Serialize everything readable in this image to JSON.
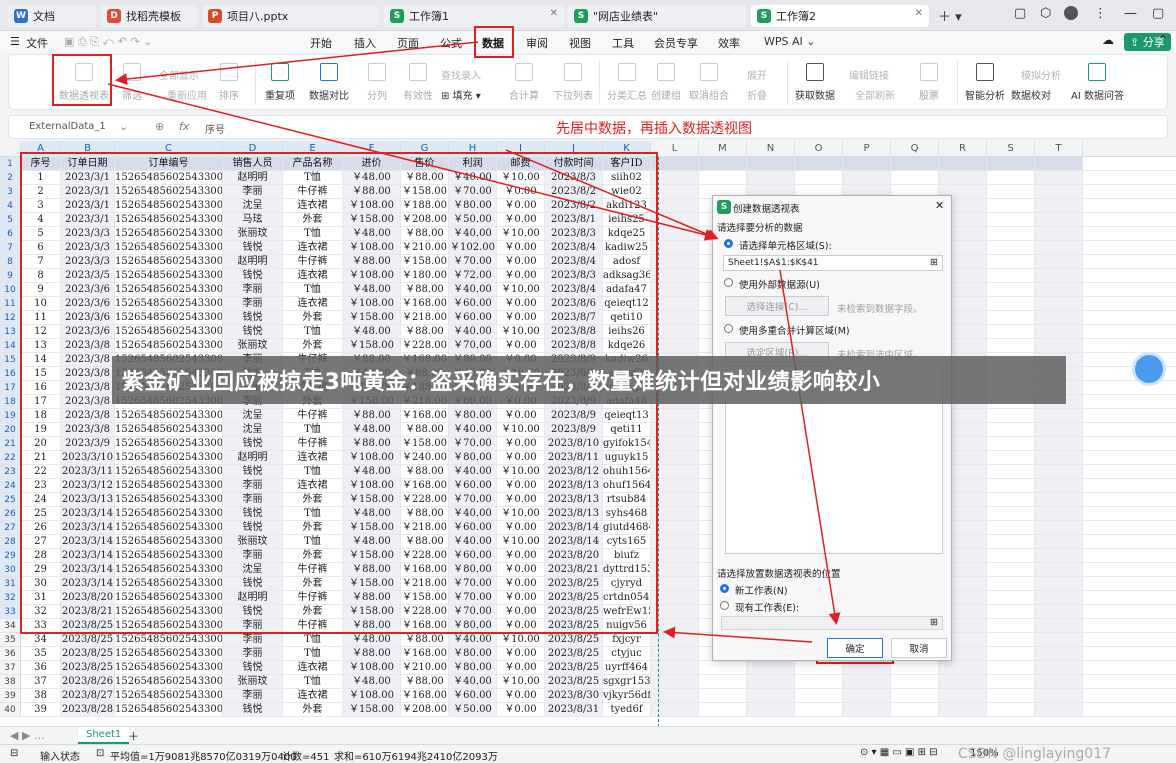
{
  "tabs": [
    {
      "label": "文档",
      "icon": "doc-icon",
      "color": "#2f6fd6"
    },
    {
      "label": "找稻壳模板",
      "icon": "docer-icon",
      "color": "#e24b3b"
    },
    {
      "label": "项目八.pptx",
      "icon": "ppt-icon",
      "color": "#d94a2a"
    },
    {
      "label": "工作簿1",
      "icon": "sheet-icon",
      "color": "#1e9e5a"
    },
    {
      "label": "\"网店业绩表\"",
      "icon": "sheet-icon",
      "color": "#1e9e5a"
    },
    {
      "label": "工作簿2",
      "icon": "sheet-icon",
      "color": "#1e9e5a"
    }
  ],
  "menu": {
    "file": "文件",
    "items": [
      "开始",
      "插入",
      "页面",
      "公式",
      "数据",
      "审阅",
      "视图",
      "工具",
      "会员专享",
      "效率"
    ],
    "wps_ai": "WPS AI",
    "share": "分享"
  },
  "ribbon": {
    "pivot": "数据透视表",
    "filter": "筛选",
    "show_all": "全部显示",
    "reapply": "重新应用",
    "sort": "排序",
    "dup": "重复项",
    "compare": "数据对比",
    "split": "分列",
    "validity": "有效性",
    "find_entry": "查找录入",
    "fill": "填充",
    "sum": "合计算",
    "dropdown": "下拉列表",
    "subtotal": "分类汇总",
    "create_group": "创建组",
    "ungroup": "取消组合",
    "expand": "展开",
    "collapse": "折叠",
    "get_data": "获取数据",
    "edit_links": "编辑链接",
    "refresh_all": "全部刷新",
    "stock": "股票",
    "smart": "智能分析",
    "simulate": "模拟分析",
    "check": "数据校对",
    "ai_qa": "AI 数据问答"
  },
  "formula": {
    "name_box": "ExternalData_1",
    "fx": "fx",
    "value": "序号"
  },
  "annotation": "先居中数据，再插入数据透视图",
  "columns": [
    "A",
    "B",
    "C",
    "D",
    "E",
    "F",
    "G",
    "H",
    "I",
    "J",
    "K",
    "L",
    "M",
    "N",
    "O",
    "P",
    "Q",
    "R",
    "S",
    "T"
  ],
  "table_header": [
    "序号",
    "订单日期",
    "订单编号",
    "销售人员",
    "产品名称",
    "进价",
    "售价",
    "利润",
    "邮费",
    "付款时间",
    "客户ID"
  ],
  "rows": [
    [
      "1",
      "2023/3/1",
      "152654856025433000",
      "赵明明",
      "T恤",
      "￥48.00",
      "￥88.00",
      "￥40.00",
      "￥10.00",
      "2023/8/3",
      "siih02"
    ],
    [
      "2",
      "2023/3/1",
      "152654856025433000",
      "李丽",
      "牛仔裤",
      "￥88.00",
      "￥158.00",
      "￥70.00",
      "￥0.00",
      "2023/8/2",
      "wie02"
    ],
    [
      "3",
      "2023/3/1",
      "152654856025433000",
      "沈呈",
      "连衣裙",
      "￥108.00",
      "￥188.00",
      "￥80.00",
      "￥0.00",
      "2023/8/2",
      "akdi123"
    ],
    [
      "4",
      "2023/3/1",
      "152654856025433000",
      "马玹",
      "外套",
      "￥158.00",
      "￥208.00",
      "￥50.00",
      "￥0.00",
      "2023/8/1",
      "ieihs25"
    ],
    [
      "5",
      "2023/3/3",
      "152654856025433000",
      "张丽玟",
      "T恤",
      "￥48.00",
      "￥88.00",
      "￥40.00",
      "￥10.00",
      "2023/8/3",
      "kdqe25"
    ],
    [
      "6",
      "2023/3/3",
      "152654856025433000",
      "钱悦",
      "连衣裙",
      "￥108.00",
      "￥210.00",
      "￥102.00",
      "￥0.00",
      "2023/8/4",
      "kadiw25"
    ],
    [
      "7",
      "2023/3/3",
      "152654856025433000",
      "赵明明",
      "牛仔裤",
      "￥88.00",
      "￥158.00",
      "￥70.00",
      "￥0.00",
      "2023/8/4",
      "adosf"
    ],
    [
      "8",
      "2023/3/5",
      "152654856025433000",
      "钱悦",
      "连衣裙",
      "￥108.00",
      "￥180.00",
      "￥72.00",
      "￥0.00",
      "2023/8/3",
      "adksag36"
    ],
    [
      "9",
      "2023/3/6",
      "152654856025433000",
      "李丽",
      "T恤",
      "￥48.00",
      "￥88.00",
      "￥40.00",
      "￥10.00",
      "2023/8/4",
      "adafa47"
    ],
    [
      "10",
      "2023/3/6",
      "152654856025433000",
      "李丽",
      "连衣裙",
      "￥108.00",
      "￥168.00",
      "￥60.00",
      "￥0.00",
      "2023/8/6",
      "qeieqt12"
    ],
    [
      "11",
      "2023/3/6",
      "152654856025433000",
      "钱悦",
      "外套",
      "￥158.00",
      "￥218.00",
      "￥60.00",
      "￥0.00",
      "2023/8/7",
      "qeti10"
    ],
    [
      "12",
      "2023/3/6",
      "152654856025433000",
      "钱悦",
      "T恤",
      "￥48.00",
      "￥88.00",
      "￥40.00",
      "￥10.00",
      "2023/8/8",
      "ieihs26"
    ],
    [
      "13",
      "2023/3/8",
      "152654856025433000",
      "张丽玟",
      "外套",
      "￥158.00",
      "￥228.00",
      "￥70.00",
      "￥0.00",
      "2023/8/8",
      "kdqe26"
    ],
    [
      "14",
      "2023/3/8",
      "152654856025433000",
      "李丽",
      "牛仔裤",
      "￥88.00",
      "￥168.00",
      "￥80.00",
      "￥0.00",
      "2023/8/9",
      "kadiw26"
    ],
    [
      "15",
      "2023/3/8",
      "152654856025433000",
      "钱悦",
      "T恤",
      "￥48.00",
      "￥88.00",
      "￥40.00",
      "￥10.00",
      "2023/8/9",
      "adosf2"
    ],
    [
      "16",
      "2023/3/8",
      "152654856025433000",
      "李丽",
      "连衣裙",
      "￥108.00",
      "￥188.00",
      "￥80.00",
      "￥0.00",
      "2023/8/9",
      "adksag37"
    ],
    [
      "17",
      "2023/3/8",
      "152654856025433000",
      "李丽",
      "外套",
      "￥158.00",
      "￥218.00",
      "￥60.00",
      "￥0.00",
      "2023/8/9",
      "adafa48"
    ],
    [
      "18",
      "2023/3/8",
      "152654856025433000",
      "沈呈",
      "牛仔裤",
      "￥88.00",
      "￥168.00",
      "￥80.00",
      "￥0.00",
      "2023/8/9",
      "qeieqt13"
    ],
    [
      "19",
      "2023/3/8",
      "152654856025433000",
      "沈呈",
      "T恤",
      "￥48.00",
      "￥88.00",
      "￥40.00",
      "￥10.00",
      "2023/8/9",
      "qeti11"
    ],
    [
      "20",
      "2023/3/9",
      "152654856025433000",
      "钱悦",
      "牛仔裤",
      "￥88.00",
      "￥158.00",
      "￥70.00",
      "￥0.00",
      "2023/8/10",
      "gyifok154"
    ],
    [
      "21",
      "2023/3/10",
      "152654856025433000",
      "赵明明",
      "连衣裙",
      "￥108.00",
      "￥240.00",
      "￥80.00",
      "￥0.00",
      "2023/8/11",
      "uguyk15"
    ],
    [
      "22",
      "2023/3/11",
      "152654856025433000",
      "钱悦",
      "T恤",
      "￥48.00",
      "￥88.00",
      "￥40.00",
      "￥10.00",
      "2023/8/12",
      "ohuh1564"
    ],
    [
      "23",
      "2023/3/12",
      "152654856025433000",
      "李丽",
      "连衣裙",
      "￥108.00",
      "￥168.00",
      "￥60.00",
      "￥0.00",
      "2023/8/13",
      "ohuf1564"
    ],
    [
      "24",
      "2023/3/13",
      "152654856025433000",
      "李丽",
      "外套",
      "￥158.00",
      "￥228.00",
      "￥70.00",
      "￥0.00",
      "2023/8/13",
      "rtsub84"
    ],
    [
      "25",
      "2023/3/14",
      "152654856025433000",
      "钱悦",
      "T恤",
      "￥48.00",
      "￥88.00",
      "￥40.00",
      "￥10.00",
      "2023/8/13",
      "syhs468"
    ],
    [
      "26",
      "2023/3/14",
      "152654856025433000",
      "钱悦",
      "外套",
      "￥158.00",
      "￥218.00",
      "￥60.00",
      "￥0.00",
      "2023/8/14",
      "giutd4684"
    ],
    [
      "27",
      "2023/3/14",
      "152654856025433000",
      "张丽玟",
      "T恤",
      "￥48.00",
      "￥88.00",
      "￥40.00",
      "￥10.00",
      "2023/8/14",
      "cyts165"
    ],
    [
      "28",
      "2023/3/14",
      "152654856025433000",
      "李丽",
      "外套",
      "￥158.00",
      "￥228.00",
      "￥60.00",
      "￥0.00",
      "2023/8/20",
      "biufz"
    ],
    [
      "29",
      "2023/3/14",
      "152654856025433000",
      "沈呈",
      "牛仔裤",
      "￥88.00",
      "￥168.00",
      "￥80.00",
      "￥0.00",
      "2023/8/21",
      "dyttrd1534"
    ],
    [
      "30",
      "2023/3/14",
      "152654856025433000",
      "钱悦",
      "外套",
      "￥158.00",
      "￥218.00",
      "￥70.00",
      "￥0.00",
      "2023/8/25",
      "cjyryd"
    ],
    [
      "31",
      "2023/8/20",
      "152654856025433000",
      "赵明明",
      "牛仔裤",
      "￥88.00",
      "￥158.00",
      "￥70.00",
      "￥0.00",
      "2023/8/25",
      "crtdn0546"
    ],
    [
      "32",
      "2023/8/21",
      "152654856025433000",
      "钱悦",
      "外套",
      "￥158.00",
      "￥228.00",
      "￥70.00",
      "￥0.00",
      "2023/8/25",
      "wefrEw150"
    ],
    [
      "33",
      "2023/8/25",
      "152654856025433000",
      "李丽",
      "牛仔裤",
      "￥88.00",
      "￥168.00",
      "￥80.00",
      "￥0.00",
      "2023/8/25",
      "nuigv56"
    ],
    [
      "34",
      "2023/8/25",
      "152654856025433000",
      "李丽",
      "T恤",
      "￥48.00",
      "￥88.00",
      "￥40.00",
      "￥10.00",
      "2023/8/25",
      "fxjcyr"
    ],
    [
      "35",
      "2023/8/25",
      "152654856025433000",
      "李丽",
      "T恤",
      "￥88.00",
      "￥168.00",
      "￥80.00",
      "￥0.00",
      "2023/8/25",
      "ctyjuc"
    ],
    [
      "36",
      "2023/8/25",
      "152654856025433000",
      "钱悦",
      "连衣裙",
      "￥108.00",
      "￥210.00",
      "￥80.00",
      "￥0.00",
      "2023/8/25",
      "uyrff464"
    ],
    [
      "37",
      "2023/8/26",
      "152654856025433000",
      "张丽玟",
      "T恤",
      "￥48.00",
      "￥88.00",
      "￥40.00",
      "￥10.00",
      "2023/8/25",
      "sgxgr1531"
    ],
    [
      "38",
      "2023/8/27",
      "152654856025433000",
      "李丽",
      "连衣裙",
      "￥108.00",
      "￥168.00",
      "￥60.00",
      "￥0.00",
      "2023/8/30",
      "vjkyr56dff"
    ],
    [
      "39",
      "2023/8/28",
      "152654856025433000",
      "钱悦",
      "外套",
      "￥158.00",
      "￥208.00",
      "￥50.00",
      "￥0.00",
      "2023/8/31",
      "tyed6f"
    ]
  ],
  "dialog": {
    "title": "创建数据透视表",
    "close": "✕",
    "section1": "请选择要分析的数据",
    "opt_range": "请选择单元格区域(S):",
    "range_value": "Sheet1!$A$1:$K$41",
    "opt_external": "使用外部数据源(U)",
    "select_conn": "选择连接(C)...",
    "no_fields": "未检索到数据字段。",
    "opt_multi": "使用多重合并计算区域(M)",
    "select_area": "选定区域(R)...",
    "no_area": "未检索到选中区域。",
    "section2": "请选择放置数据透视表的位置",
    "opt_new": "新工作表(N)",
    "opt_exist": "现有工作表(E):",
    "ok": "确定",
    "cancel": "取消"
  },
  "overlay_title": "紫金矿业回应被掠走3吨黄金：盗采确实存在，数量难统计但对业绩影响较小",
  "sheet_tab": "Sheet1",
  "status": {
    "mode": "输入状态",
    "avg": "平均值=1万9081兆8570亿0319万0400",
    "count": "计数=451",
    "sum": "求和=610万6194兆2410亿2093万",
    "zoom": "150%",
    "watermark": "CSDN @linglaying017"
  }
}
